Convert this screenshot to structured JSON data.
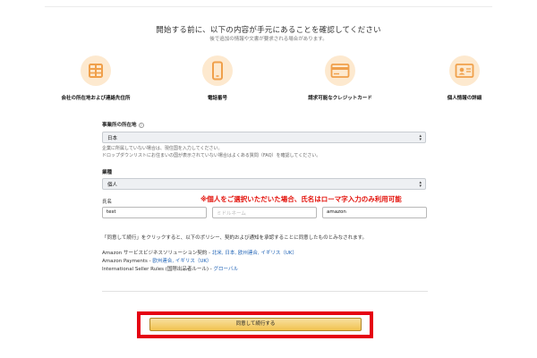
{
  "header": {
    "title": "開始する前に、以下の内容が手元にあることを確認してください",
    "subtitle": "後で追加の情報や文書が要求される場合があります。"
  },
  "requirements": [
    {
      "icon": "building-icon",
      "label": "会社の所在地および連絡先住所"
    },
    {
      "icon": "phone-icon",
      "label": "電話番号"
    },
    {
      "icon": "credit-card-icon",
      "label": "請求可能なクレジットカード"
    },
    {
      "icon": "id-card-icon",
      "label": "個人情報の詳細"
    }
  ],
  "form": {
    "location_label": "事業所の所在地",
    "location_value": "日本",
    "location_help_1": "企業に所属していない場合は、現住国を入力してください。",
    "location_help_2": "ドロップダウンリストにお住まいの国が表示されていない場合はよくある質問（FAQ）を確認してください。",
    "business_type_label": "業種",
    "business_type_value": "個人",
    "name_label": "氏名",
    "first_name_value": "test",
    "middle_name_placeholder": "ミドルネーム",
    "last_name_value": "amazon",
    "annotation": "※個人をご選択いただいた場合、氏名はローマ字入力のみ利用可能"
  },
  "agreement": {
    "text": "「同意して続行」をクリックすると、以下のポリシー、契約および通知を承認することに同意したものとみなされます。",
    "policies": [
      {
        "prefix": "Amazon サービスビジネスソリューション契約 - ",
        "links": "北米, 日本, 欧州連合, イギリス（UK）"
      },
      {
        "prefix": "Amazon Payments - ",
        "links": "欧州連合, イギリス（UK）"
      },
      {
        "prefix": "International Seller Rules (国際出品者ルール) - ",
        "links": "グローバル"
      }
    ]
  },
  "submit_label": "同意して続行する",
  "colors": {
    "accent_red": "#e50012",
    "button_gold": "#f1c34f",
    "icon_orange": "#f0a04b",
    "icon_bg": "#fde9cf",
    "link_blue": "#1a5fb4"
  }
}
